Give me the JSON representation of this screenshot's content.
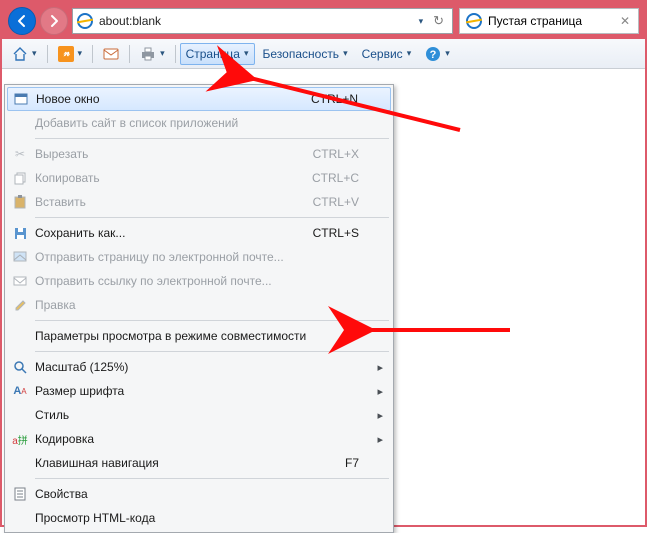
{
  "address_bar": {
    "url": "about:blank"
  },
  "tab": {
    "title": "Пустая страница"
  },
  "cmdbar": {
    "page": "Страница",
    "safety": "Безопасность",
    "tools": "Сервис"
  },
  "menu": {
    "new_window": "Новое окно",
    "new_window_sc": "CTRL+N",
    "add_site": "Добавить сайт в список приложений",
    "cut": "Вырезать",
    "cut_sc": "CTRL+X",
    "copy": "Копировать",
    "copy_sc": "CTRL+C",
    "paste": "Вставить",
    "paste_sc": "CTRL+V",
    "save_as": "Сохранить как...",
    "save_as_sc": "CTRL+S",
    "send_page": "Отправить страницу по электронной почте...",
    "send_link": "Отправить ссылку по электронной почте...",
    "edit": "Правка",
    "compat_view": "Параметры просмотра в режиме совместимости",
    "zoom": "Масштаб (125%)",
    "text_size": "Размер шрифта",
    "style": "Стиль",
    "encoding": "Кодировка",
    "caret": "Клавишная навигация",
    "caret_sc": "F7",
    "properties": "Свойства",
    "view_source": "Просмотр HTML-кода"
  }
}
